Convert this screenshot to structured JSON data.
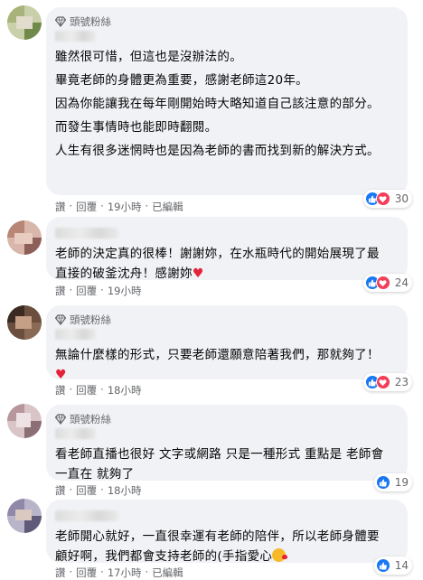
{
  "comments": [
    {
      "badge": "頭號粉絲",
      "lines": [
        "雖然很可惜，但這也是沒辦法的。",
        "畢竟老師的身體更為重要，感謝老師這20年。",
        "因為你能讓我在每年剛開始時大略知道自己該注意的部分。",
        "而發生事情時也能即時翻閱。",
        "人生有很多迷惘時也是因為老師的書而找到新的解決方式。"
      ],
      "actions": [
        "讚",
        "回覆",
        "19小時",
        "已編輯"
      ],
      "reactions": "30"
    },
    {
      "lines": [
        "老師的決定真的很棒！謝謝妳，在水瓶時代的開始展現了最直接的破釜沈舟！感謝妳"
      ],
      "actions": [
        "讚",
        "回覆",
        "19小時"
      ],
      "reactions": "24",
      "trailing_icon": "heart-icon"
    },
    {
      "badge": "頭號粉絲",
      "lines": [
        "無論什麼樣的形式，只要老師還願意陪著我們，那就夠了！"
      ],
      "actions": [
        "讚",
        "回覆",
        "18小時"
      ],
      "reactions": "23",
      "trailing_icon": "heart-icon"
    },
    {
      "badge": "頭號粉絲",
      "lines": [
        "看老師直播也很好 文字或網路 只是一種形式 重點是 老師會一直在 就夠了"
      ],
      "actions": [
        "讚",
        "回覆",
        "18小時"
      ],
      "reactions": "19"
    },
    {
      "lines": [
        "老師開心就好，一直很幸運有老師的陪伴，所以老師身體要顧好啊，我們都會支持老師的(手指愛心"
      ],
      "actions": [
        "讚",
        "回覆",
        "17小時",
        "已編輯"
      ],
      "reactions": "14",
      "trailing_icon": "kiss-emoji-icon"
    }
  ],
  "colors": {
    "bubble": "#f0f2f5",
    "like": "#1877f2",
    "love": "#f33e58",
    "meta": "#65676b"
  }
}
